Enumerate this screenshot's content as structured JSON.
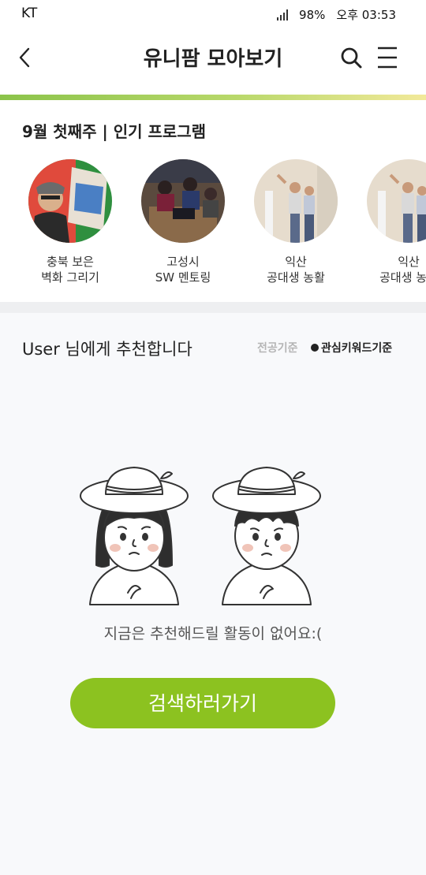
{
  "status_bar": {
    "carrier": "KT",
    "battery": "98%",
    "time": "오후 03:53"
  },
  "header": {
    "title": "유니팜 모아보기"
  },
  "weekly": {
    "title": "9월 첫째주 | 인기 프로그램",
    "programs": [
      {
        "name": "충북 보은\n벽화 그리기"
      },
      {
        "name": "고성시\nSW 멘토링"
      },
      {
        "name": "익산\n공대생 농활"
      },
      {
        "name": "익산\n공대생 농활"
      }
    ]
  },
  "recommend": {
    "title": "User 님에게 추천합니다",
    "filter_major": "전공기준",
    "filter_keyword": "관심키워드기준",
    "empty_message": "지금은 추천해드릴 활동이 없어요:(",
    "search_button": "검색하러가기"
  },
  "colors": {
    "accent": "#8cc220",
    "gradient_start": "#8bc34a",
    "gradient_end": "#f2e99a"
  }
}
